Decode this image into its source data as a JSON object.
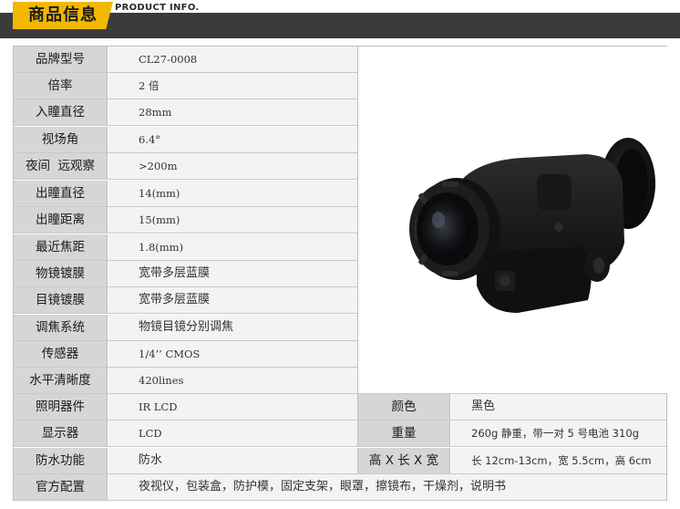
{
  "header": {
    "title": "商品信息",
    "subtitle": "PRODUCT INFO."
  },
  "specs": [
    {
      "label": "品牌型号",
      "value": "CL27-0008"
    },
    {
      "label": "倍率",
      "value": "2 倍"
    },
    {
      "label": "入瞳直径",
      "value": "28mm"
    },
    {
      "label": "视场角",
      "value": "6.4°"
    },
    {
      "label": "夜间  远观察",
      "value": ">200m"
    },
    {
      "label": "出瞳直径",
      "value": "14(mm)"
    },
    {
      "label": "出瞳距离",
      "value": "15(mm)"
    },
    {
      "label": "最近焦距",
      "value": "1.8(mm)"
    },
    {
      "label": "物镜镀膜",
      "value": "宽带多层蓝膜"
    },
    {
      "label": "目镜镀膜",
      "value": "宽带多层蓝膜"
    },
    {
      "label": "调焦系统",
      "value": "物镜目镜分别调焦"
    },
    {
      "label": "传感器",
      "value": "1/4’’ CMOS"
    },
    {
      "label": "水平清晰度",
      "value": "420lines"
    },
    {
      "label": "照明器件",
      "value": "IR LCD"
    },
    {
      "label": "显示器",
      "value": "LCD"
    },
    {
      "label": "防水功能",
      "value": "防水"
    },
    {
      "label": "官方配置",
      "value": "夜视仪，包装盒，防护模，固定支架，眼罩，擦镜布，干燥剂，说明书"
    }
  ],
  "extra_specs": [
    {
      "label": "颜色",
      "value": "黑色"
    },
    {
      "label": "重量",
      "value": "260g 静重，带一对 5 号电池 310g"
    },
    {
      "label": "高 X 长 X 宽",
      "value": "长 12cm-13cm，宽 5.5cm，高 6cm"
    }
  ],
  "colors": {
    "header_bar": "#3a3a3a",
    "header_accent": "#f2b701",
    "label_bg": "#d6d6d6",
    "value_bg": "#f3f3f3",
    "border": "#bdbdbd"
  },
  "product_image": {
    "icon": "night-vision-monocular-photo"
  }
}
